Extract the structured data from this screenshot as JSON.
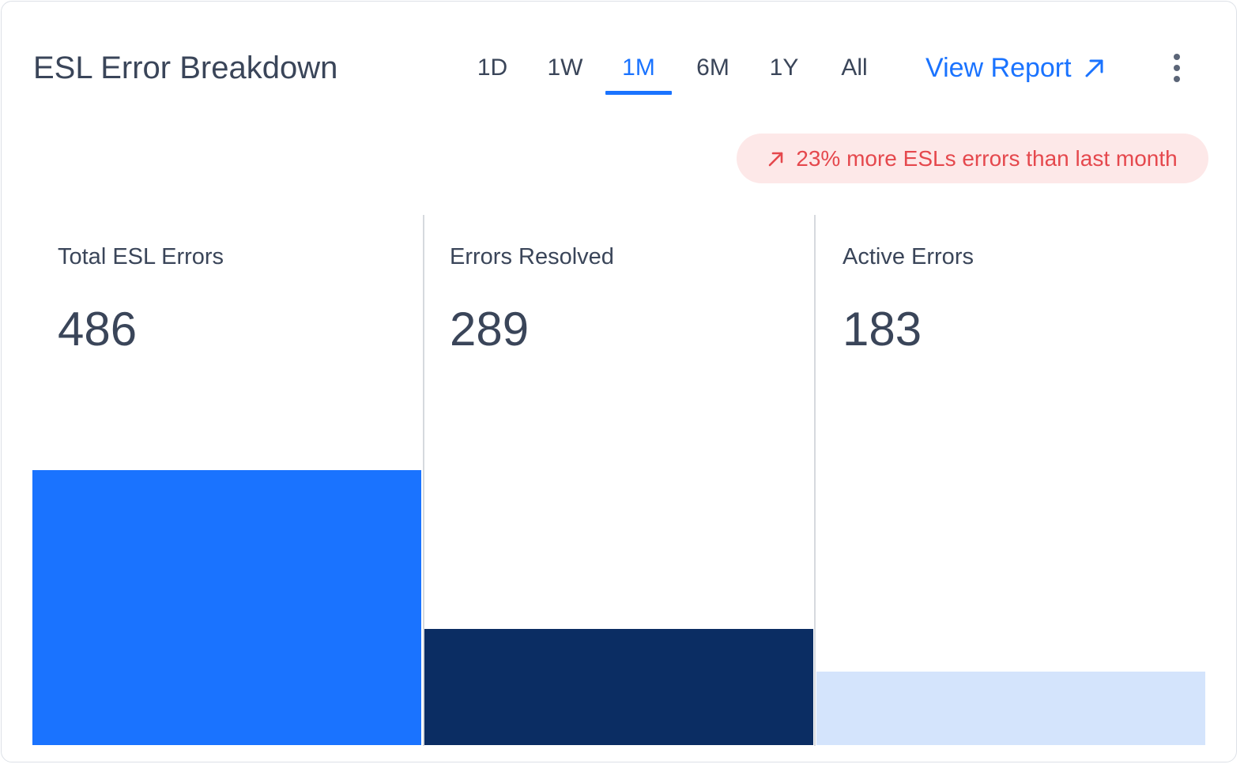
{
  "header": {
    "title": "ESL Error Breakdown",
    "view_report_label": "View Report"
  },
  "tabs": [
    {
      "label": "1D",
      "active": false
    },
    {
      "label": "1W",
      "active": false
    },
    {
      "label": "1M",
      "active": true
    },
    {
      "label": "6M",
      "active": false
    },
    {
      "label": "1Y",
      "active": false
    },
    {
      "label": "All",
      "active": false
    }
  ],
  "trend": {
    "text": "23% more ESLs errors than last month",
    "color": "#e5484d",
    "background": "#fde8e8"
  },
  "stats": [
    {
      "label": "Total ESL Errors",
      "value": "486",
      "bar_color": "#1a73ff"
    },
    {
      "label": "Errors Resolved",
      "value": "289",
      "bar_color": "#0b2d63"
    },
    {
      "label": "Active Errors",
      "value": "183",
      "bar_color": "#d4e4fc"
    }
  ],
  "chart_data": {
    "type": "bar",
    "categories": [
      "Total ESL Errors",
      "Errors Resolved",
      "Active Errors"
    ],
    "values": [
      486,
      289,
      183
    ]
  },
  "colors": {
    "accent": "#1a73ff",
    "text": "#3a4559",
    "divider": "#d6d9de"
  },
  "icons": {
    "view_report": "arrow-up-right-icon",
    "more": "kebab-menu-icon",
    "trend": "trend-up-arrow-icon"
  }
}
